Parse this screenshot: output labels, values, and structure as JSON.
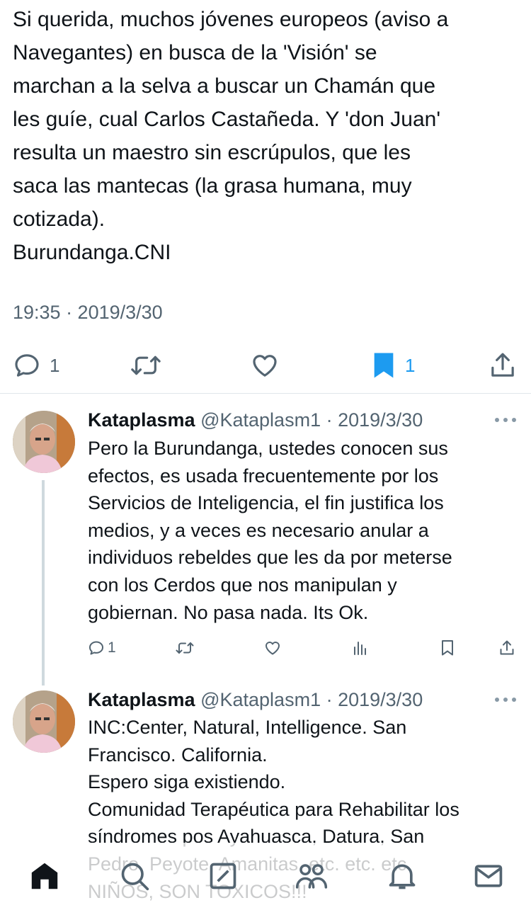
{
  "main_tweet": {
    "text": "Si querida, muchos jóvenes europeos (aviso a\nNavegantes) en busca de la 'Visión' se\nmarchan a la selva a buscar un Chamán que\nles guíe, cual Carlos Castañeda. Y 'don Juan'\nresulta un maestro sin escrúpulos, que les\nsaca las mantecas (la grasa humana, muy\ncotizada).\nBurundanga.CNI",
    "timestamp": "19:35 · 2019/3/30",
    "reply_count": "1",
    "bookmark_count": "1"
  },
  "replies": [
    {
      "name": "Kataplasma",
      "handle": "@Kataplasm1",
      "date": "· 2019/3/30",
      "text": "Pero la Burundanga, ustedes conocen sus\nefectos, es usada frecuentemente por los\nServicios de Inteligencia, el fin justifica los\nmedios, y a veces es necesario anular a\nindividuos rebeldes que les da por meterse\ncon los Cerdos que nos manipulan y\ngobiernan. No pasa nada. Its Ok.",
      "reply_count": "1"
    },
    {
      "name": "Kataplasma",
      "handle": "@Kataplasm1",
      "date": "· 2019/3/30",
      "text": "INC:Center, Natural, Intelligence. San\nFrancisco. California.\nEspero siga existiendo.\nComunidad Terapéutica para Rehabilitar los\nsíndromes pos Ayahuasca, Datura, San\nPedro, Peyote, Amanitas, etc. etc. etc\nNIÑOS, SON TOXICOS!!!"
    }
  ],
  "icons": {
    "reply": "speech-bubble-icon",
    "retweet": "retweet-icon",
    "like": "heart-icon",
    "bookmark": "bookmark-icon",
    "share": "share-icon",
    "views": "bar-chart-icon",
    "more": "more-dots-icon",
    "tabs": [
      "home-icon",
      "search-icon",
      "compose-icon",
      "communities-icon",
      "bell-icon",
      "mail-icon"
    ]
  },
  "colors": {
    "accent": "#1d9bf0",
    "text": "#0f1419",
    "secondary": "#536471"
  }
}
